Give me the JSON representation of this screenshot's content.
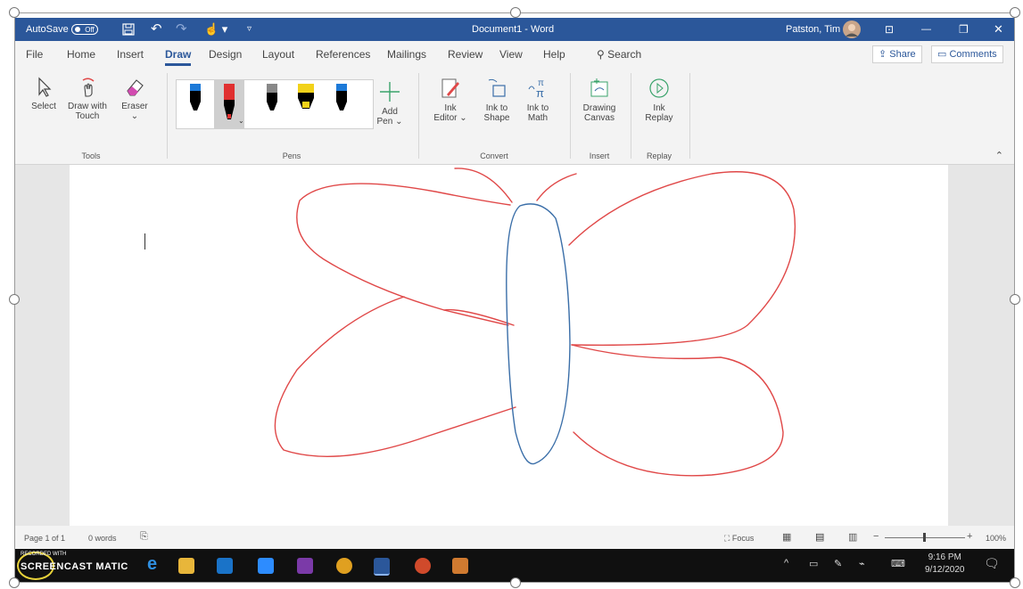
{
  "titlebar": {
    "autosave_label": "AutoSave",
    "autosave_state": "Off",
    "document_title": "Document1 - Word",
    "user_name": "Patston, Tim"
  },
  "tabs": [
    "File",
    "Home",
    "Insert",
    "Draw",
    "Design",
    "Layout",
    "References",
    "Mailings",
    "Review",
    "View",
    "Help"
  ],
  "active_tab": "Draw",
  "search_label": "Search",
  "share_label": "Share",
  "comments_label": "Comments",
  "ribbon": {
    "tools": {
      "select": "Select",
      "draw_with_touch": "Draw with Touch",
      "eraser": "Eraser",
      "label": "Tools"
    },
    "pens": {
      "add_pen": "Add Pen",
      "label": "Pens"
    },
    "convert": {
      "ink_editor": "Ink Editor",
      "ink_to_shape": "Ink to Shape",
      "ink_to_math": "Ink to Math",
      "label": "Convert"
    },
    "insert": {
      "drawing_canvas": "Drawing Canvas",
      "label": "Insert"
    },
    "replay": {
      "ink_replay": "Ink Replay",
      "label": "Replay"
    }
  },
  "status": {
    "page": "Page 1 of 1",
    "words": "0 words",
    "focus": "Focus",
    "zoom": "100%"
  },
  "taskbar": {
    "recorded_with": "RECORDED WITH",
    "brand": "SCREENCAST MATIC",
    "time": "9:16 PM",
    "date": "9/12/2020"
  },
  "colors": {
    "word_blue": "#2b579a",
    "ink_red": "#e04848",
    "ink_blue": "#3a6ea8"
  }
}
